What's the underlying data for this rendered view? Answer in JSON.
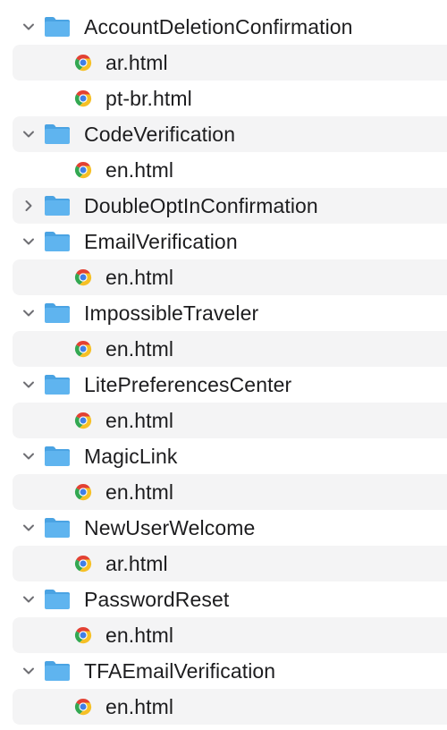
{
  "tree": [
    {
      "type": "folder",
      "name": "AccountDeletionConfirmation",
      "expanded": true,
      "icon": "folder-icon"
    },
    {
      "type": "file",
      "name": "ar.html",
      "icon": "chrome-icon"
    },
    {
      "type": "file",
      "name": "pt-br.html",
      "icon": "chrome-icon"
    },
    {
      "type": "folder",
      "name": "CodeVerification",
      "expanded": true,
      "icon": "folder-icon"
    },
    {
      "type": "file",
      "name": "en.html",
      "icon": "chrome-icon"
    },
    {
      "type": "folder",
      "name": "DoubleOptInConfirmation",
      "expanded": false,
      "icon": "folder-icon"
    },
    {
      "type": "folder",
      "name": "EmailVerification",
      "expanded": true,
      "icon": "folder-icon"
    },
    {
      "type": "file",
      "name": "en.html",
      "icon": "chrome-icon"
    },
    {
      "type": "folder",
      "name": "ImpossibleTraveler",
      "expanded": true,
      "icon": "folder-icon"
    },
    {
      "type": "file",
      "name": "en.html",
      "icon": "chrome-icon"
    },
    {
      "type": "folder",
      "name": "LitePreferencesCenter",
      "expanded": true,
      "icon": "folder-icon"
    },
    {
      "type": "file",
      "name": "en.html",
      "icon": "chrome-icon"
    },
    {
      "type": "folder",
      "name": "MagicLink",
      "expanded": true,
      "icon": "folder-icon"
    },
    {
      "type": "file",
      "name": "en.html",
      "icon": "chrome-icon"
    },
    {
      "type": "folder",
      "name": "NewUserWelcome",
      "expanded": true,
      "icon": "folder-icon"
    },
    {
      "type": "file",
      "name": "ar.html",
      "icon": "chrome-icon"
    },
    {
      "type": "folder",
      "name": "PasswordReset",
      "expanded": true,
      "icon": "folder-icon"
    },
    {
      "type": "file",
      "name": "en.html",
      "icon": "chrome-icon"
    },
    {
      "type": "folder",
      "name": "TFAEmailVerification",
      "expanded": true,
      "icon": "folder-icon"
    },
    {
      "type": "file",
      "name": "en.html",
      "icon": "chrome-icon"
    }
  ],
  "colors": {
    "text": "#1d1d1f",
    "stripe": "#f4f4f5",
    "folder_front": "#5fb4ef",
    "folder_back": "#4aa3e3",
    "chevron": "#6e6e73"
  }
}
